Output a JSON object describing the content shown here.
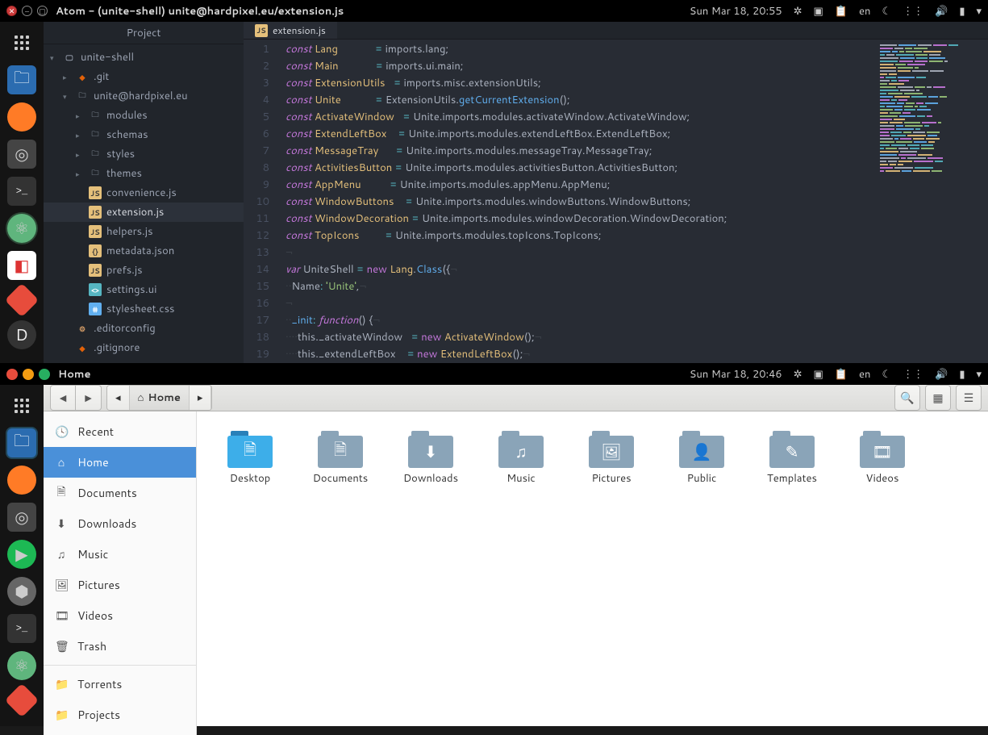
{
  "top": {
    "title": "Atom - (unite-shell) unite@hardpixel.eu/extension.js",
    "clock": "Sun Mar 18, 20:55",
    "lang": "en"
  },
  "atom": {
    "sidebar_title": "Project",
    "tree": {
      "root": "unite-shell",
      "git": ".git",
      "pkg": "unite@hardpixel.eu",
      "folders": [
        "modules",
        "schemas",
        "styles",
        "themes"
      ],
      "files": [
        {
          "n": "convenience.js",
          "t": "js"
        },
        {
          "n": "extension.js",
          "t": "js",
          "sel": true
        },
        {
          "n": "helpers.js",
          "t": "js"
        },
        {
          "n": "metadata.json",
          "t": "json"
        },
        {
          "n": "prefs.js",
          "t": "js"
        },
        {
          "n": "settings.ui",
          "t": "ui"
        },
        {
          "n": "stylesheet.css",
          "t": "css"
        }
      ],
      "rootfiles": [
        {
          "n": ".editorconfig",
          "t": "cfg"
        },
        {
          "n": ".gitignore",
          "t": "git"
        }
      ]
    },
    "tab": "extension.js",
    "code": [
      {
        "n": 1,
        "h": "<span class='kw'>const</span> <span class='nm'>Lang</span>             <span class='op'>=</span> imports.lang;"
      },
      {
        "n": 2,
        "h": "<span class='kw'>const</span> <span class='nm'>Main</span>             <span class='op'>=</span> imports.ui.main;"
      },
      {
        "n": 3,
        "h": "<span class='kw'>const</span> <span class='nm'>ExtensionUtils</span>   <span class='op'>=</span> imports.misc.extensionUtils;"
      },
      {
        "n": 4,
        "h": "<span class='kw'>const</span> <span class='nm'>Unite</span>            <span class='op'>=</span> ExtensionUtils.<span class='fn'>getCurrentExtension</span>();"
      },
      {
        "n": 5,
        "h": "<span class='kw'>const</span> <span class='nm'>ActivateWindow</span>   <span class='op'>=</span> Unite.imports.modules.activateWindow.ActivateWindow;"
      },
      {
        "n": 6,
        "h": "<span class='kw'>const</span> <span class='nm'>ExtendLeftBox</span>    <span class='op'>=</span> Unite.imports.modules.extendLeftBox.ExtendLeftBox;"
      },
      {
        "n": 7,
        "h": "<span class='kw'>const</span> <span class='nm'>MessageTray</span>      <span class='op'>=</span> Unite.imports.modules.messageTray.MessageTray;"
      },
      {
        "n": 8,
        "h": "<span class='kw'>const</span> <span class='nm'>ActivitiesButton</span> <span class='op'>=</span> Unite.imports.modules.activitiesButton.ActivitiesButton;"
      },
      {
        "n": 9,
        "h": "<span class='kw'>const</span> <span class='nm'>AppMenu</span>          <span class='op'>=</span> Unite.imports.modules.appMenu.AppMenu;"
      },
      {
        "n": 10,
        "h": "<span class='kw'>const</span> <span class='nm'>WindowButtons</span>    <span class='op'>=</span> Unite.imports.modules.windowButtons.WindowButtons;"
      },
      {
        "n": 11,
        "h": "<span class='kw'>const</span> <span class='nm'>WindowDecoration</span> <span class='op'>=</span> Unite.imports.modules.windowDecoration.WindowDecoration;"
      },
      {
        "n": 12,
        "h": "<span class='kw'>const</span> <span class='nm'>TopIcons</span>         <span class='op'>=</span> Unite.imports.modules.topIcons.TopIcons;"
      },
      {
        "n": 13,
        "h": "<span class='inv'>¬</span>"
      },
      {
        "n": 14,
        "h": "<span class='kw'>var</span> UniteShell <span class='op'>=</span> <span class='new'>new</span> <span class='cls'>Lang</span>.<span class='fn'>Class</span>({<span class='inv'>¬</span>"
      },
      {
        "n": 15,
        "h": "<span class='inv'>·</span><span class='inv'>·</span>Name<span class='op'>:</span> <span class='str'>'Unite'</span>,<span class='inv'>¬</span>"
      },
      {
        "n": 16,
        "h": "<span class='inv'>¬</span>"
      },
      {
        "n": 17,
        "h": "<span class='inv'>·</span><span class='inv'>·</span><span class='fn'>_init</span><span class='op'>:</span> <span class='kw'>function</span>() {<span class='inv'>¬</span>"
      },
      {
        "n": 18,
        "h": "<span class='inv'>·</span><span class='inv'>·</span><span class='inv'>·</span><span class='inv'>·</span>this._activateWindow   <span class='op'>=</span> <span class='new'>new</span> <span class='cls'>ActivateWindow</span>();<span class='inv'>¬</span>"
      },
      {
        "n": 19,
        "h": "<span class='inv'>·</span><span class='inv'>·</span><span class='inv'>·</span><span class='inv'>·</span>this._extendLeftBox    <span class='op'>=</span> <span class='new'>new</span> <span class='cls'>ExtendLeftBox</span>();<span class='inv'>¬</span>"
      }
    ]
  },
  "bottom": {
    "title": "Home",
    "clock": "Sun Mar 18, 20:46",
    "lang": "en",
    "path_home": "Home",
    "sidebar": [
      {
        "icon": "🕓",
        "label": "Recent"
      },
      {
        "icon": "⌂",
        "label": "Home",
        "act": true
      },
      {
        "icon": "🗎",
        "label": "Documents"
      },
      {
        "icon": "⬇",
        "label": "Downloads"
      },
      {
        "icon": "♫",
        "label": "Music"
      },
      {
        "icon": "🖼",
        "label": "Pictures"
      },
      {
        "icon": "🎞",
        "label": "Videos"
      },
      {
        "icon": "🗑",
        "label": "Trash"
      },
      {
        "icon": "📁",
        "label": "Torrents",
        "sep": true
      },
      {
        "icon": "📁",
        "label": "Projects"
      }
    ],
    "folders": [
      {
        "n": "Desktop",
        "sym": "🗎",
        "cls": "desktop"
      },
      {
        "n": "Documents",
        "sym": "🗎"
      },
      {
        "n": "Downloads",
        "sym": "⬇"
      },
      {
        "n": "Music",
        "sym": "♫"
      },
      {
        "n": "Pictures",
        "sym": "🖼"
      },
      {
        "n": "Public",
        "sym": "👤"
      },
      {
        "n": "Templates",
        "sym": "✎"
      },
      {
        "n": "Videos",
        "sym": "🎞"
      }
    ]
  }
}
